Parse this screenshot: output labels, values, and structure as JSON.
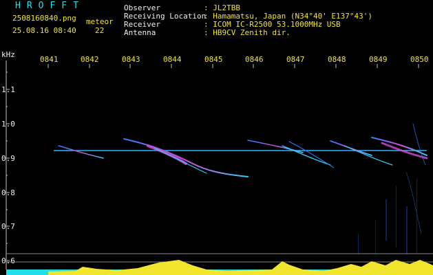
{
  "header": {
    "logo": "HROFFT",
    "filename": "2508160840.png",
    "timestamp": "25.08.16 08:40",
    "meteor_label": "meteor",
    "meteor_count": "22",
    "fields": [
      {
        "key": "Observer",
        "value": ": JL2TBB"
      },
      {
        "key": "Receiving Location",
        "value": ": Hamamatsu, Japan (N34°40' E137°43')"
      },
      {
        "key": "Receiver",
        "value": ": ICOM IC-R2500 53.1000MHz USB"
      },
      {
        "key": "Antenna",
        "value": ": HB9CV Zenith dir."
      }
    ]
  },
  "axis": {
    "unit": "kHz",
    "time_ticks": [
      "0841",
      "0842",
      "0843",
      "0844",
      "0845",
      "0846",
      "0847",
      "0848",
      "0849",
      "0850"
    ],
    "freq_ticks": [
      "1.1",
      "1.0",
      "0.9",
      "0.8",
      "0.7",
      "0.6"
    ]
  },
  "colors": {
    "text_cyan": "#22e0e8",
    "text_yellow": "#f2e52e",
    "trace": "#2fb4ff",
    "level_yellow": "#f2e52e",
    "level_cyan": "#22e0e8"
  }
}
